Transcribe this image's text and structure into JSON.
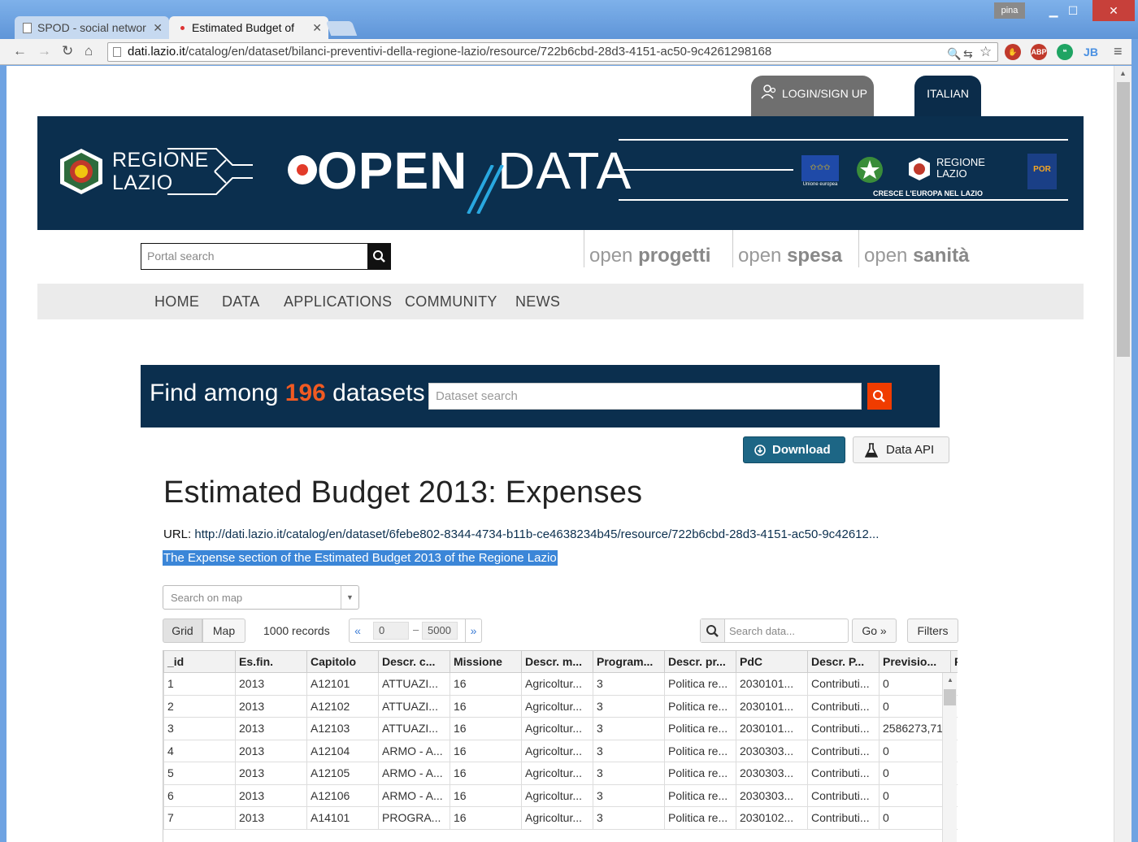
{
  "browser": {
    "tabs": [
      {
        "label": "SPOD - social networ",
        "active": false
      },
      {
        "label": "Estimated Budget of",
        "active": true
      }
    ],
    "user_badge": "pina",
    "address": {
      "host": "dati.lazio.it",
      "path": "/catalog/en/dataset/bilanci-preventivi-della-regione-lazio/resource/722b6cbd-28d3-4151-ac50-9c4261298168"
    },
    "extensions": [
      {
        "icon": "stop-icon",
        "color": "#c0392b"
      },
      {
        "icon": "abp-icon",
        "label": "ABP",
        "color": "#c0392b"
      },
      {
        "icon": "hangouts-icon",
        "color": "#1fa463"
      },
      {
        "icon": "jetbrains-icon",
        "label": "JB",
        "color": "#4a90e2"
      }
    ]
  },
  "header": {
    "login_label": "LOGIN/SIGN UP",
    "language_label": "ITALIAN",
    "region_line1": "REGIONE",
    "region_line2": "LAZIO",
    "opendata_open": "OPEN",
    "opendata_data": "DATA",
    "partner_tagline": "CRESCE L'EUROPA NEL LAZIO",
    "partner_region1": "REGIONE",
    "partner_region2": "LAZIO",
    "eu_label": "Unione europea",
    "por_label": "POR"
  },
  "search": {
    "portal_placeholder": "Portal search",
    "open_links": [
      {
        "light": "open ",
        "bold": "progetti"
      },
      {
        "light": "open ",
        "bold": "spesa"
      },
      {
        "light": "open ",
        "bold": "sanità"
      }
    ]
  },
  "nav": [
    "HOME",
    "DATA",
    "APPLICATIONS",
    "COMMUNITY",
    "NEWS"
  ],
  "find": {
    "prefix": "Find among ",
    "count": "196",
    "suffix": " datasets",
    "placeholder": "Dataset search"
  },
  "actions": {
    "download": "Download",
    "data_api": "Data API"
  },
  "resource": {
    "title": "Estimated Budget 2013: Expenses",
    "url_label": "URL:",
    "url": "http://dati.lazio.it/catalog/en/dataset/6febe802-8344-4734-b11b-ce4638234b45/resource/722b6cbd-28d3-4151-ac50-9c42612...",
    "description": "The Expense section of the Estimated Budget 2013 of the Regione Lazio"
  },
  "view": {
    "map_placeholder": "Search on map",
    "grid_label": "Grid",
    "map_label": "Map",
    "records": "1000 records",
    "pager_prev": "«",
    "pager_from": "0",
    "pager_dash": "–",
    "pager_to": "5000",
    "pager_next": "»",
    "search_placeholder": "Search data...",
    "go_label": "Go »",
    "filters_label": "Filters"
  },
  "grid": {
    "columns": [
      "_id",
      "Es.fin.",
      "Capitolo",
      "Descr. c...",
      "Missione",
      "Descr. m...",
      "Program...",
      "Descr. pr...",
      "PdC",
      "Descr. P...",
      "Previsio...",
      "P"
    ],
    "rows": [
      [
        "1",
        "2013",
        "A12101",
        "ATTUAZI...",
        "16",
        "Agricoltur...",
        "3",
        "Politica re...",
        "2030101...",
        "Contributi...",
        "0"
      ],
      [
        "2",
        "2013",
        "A12102",
        "ATTUAZI...",
        "16",
        "Agricoltur...",
        "3",
        "Politica re...",
        "2030101...",
        "Contributi...",
        "0"
      ],
      [
        "3",
        "2013",
        "A12103",
        "ATTUAZI...",
        "16",
        "Agricoltur...",
        "3",
        "Politica re...",
        "2030101...",
        "Contributi...",
        "2586273,71"
      ],
      [
        "4",
        "2013",
        "A12104",
        "ARMO - A...",
        "16",
        "Agricoltur...",
        "3",
        "Politica re...",
        "2030303...",
        "Contributi...",
        "0"
      ],
      [
        "5",
        "2013",
        "A12105",
        "ARMO - A...",
        "16",
        "Agricoltur...",
        "3",
        "Politica re...",
        "2030303...",
        "Contributi...",
        "0"
      ],
      [
        "6",
        "2013",
        "A12106",
        "ARMO - A...",
        "16",
        "Agricoltur...",
        "3",
        "Politica re...",
        "2030303...",
        "Contributi...",
        "0"
      ],
      [
        "7",
        "2013",
        "A14101",
        "PROGRA...",
        "16",
        "Agricoltur...",
        "3",
        "Politica re...",
        "2030102...",
        "Contributi...",
        "0"
      ]
    ]
  }
}
